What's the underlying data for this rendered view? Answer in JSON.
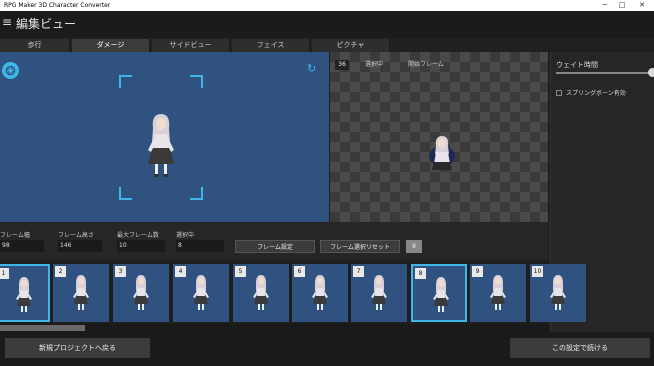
{
  "window": {
    "title": "RPG Maker 3D Character Converter",
    "min_glyph": "─",
    "max_glyph": "□",
    "close_glyph": "✕"
  },
  "header": {
    "menu_glyph": "≡",
    "title": "編集ビュー"
  },
  "tabs": [
    {
      "label": "歩行",
      "active": false
    },
    {
      "label": "ダメージ",
      "active": true
    },
    {
      "label": "サイドビュー",
      "active": false
    },
    {
      "label": "フェイス",
      "active": false
    },
    {
      "label": "ピクチャ",
      "active": false
    }
  ],
  "preview": {
    "camera_icon": "camera-shutter-icon",
    "refresh_icon": "refresh-icon",
    "refresh_glyph": "↻",
    "accent_color": "#3fb6e6",
    "background_color": "#2f5280"
  },
  "reference": {
    "number": "36",
    "selected_label": "選択中",
    "start_frame_label": "開始フレーム"
  },
  "side": {
    "wait_label": "ウェイト時間",
    "spring_label": "スプリングボーン有効"
  },
  "controls": {
    "frame_width_label": "フレーム幅",
    "frame_width_value": "98",
    "frame_height_label": "フレーム高さ",
    "frame_height_value": "146",
    "max_frames_label": "最大フレーム数",
    "max_frames_value": "10",
    "selected_label": "選択中",
    "selected_value": "8",
    "frame_settings_button": "フレーム設定",
    "reset_selection_button": "フレーム選択リセット",
    "pause_glyph": "II"
  },
  "frames": [
    {
      "number": "1",
      "selected": true
    },
    {
      "number": "2",
      "selected": false
    },
    {
      "number": "3",
      "selected": false
    },
    {
      "number": "4",
      "selected": false
    },
    {
      "number": "5",
      "selected": false
    },
    {
      "number": "6",
      "selected": false
    },
    {
      "number": "7",
      "selected": false
    },
    {
      "number": "8",
      "selected": true
    },
    {
      "number": "9",
      "selected": false
    },
    {
      "number": "10",
      "selected": false
    }
  ],
  "footer": {
    "back_button": "新規プロジェクトへ戻る",
    "continue_button": "この設定で続ける"
  }
}
